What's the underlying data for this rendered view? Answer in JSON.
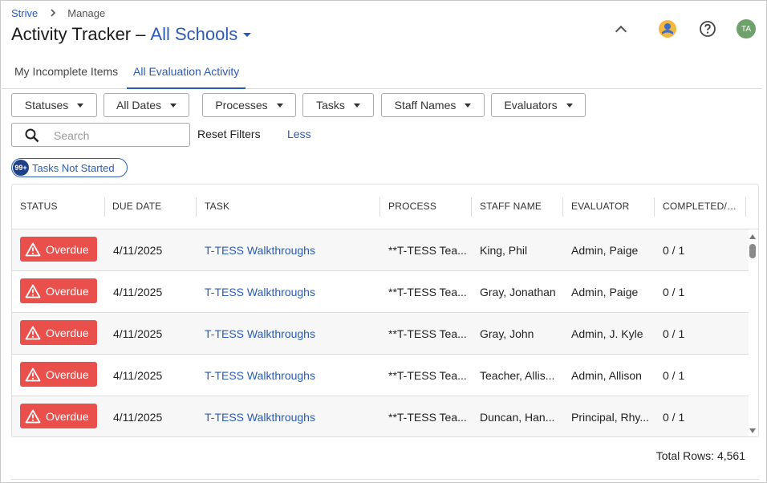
{
  "breadcrumb": {
    "root": "Strive",
    "current": "Manage"
  },
  "header": {
    "title": "Activity Tracker",
    "dash": "–",
    "school": "All Schools",
    "avatar_initials": "TA"
  },
  "tabs": [
    {
      "label": "My Incomplete Items",
      "active": false
    },
    {
      "label": "All Evaluation Activity",
      "active": true
    }
  ],
  "filters": {
    "statuses": "Statuses",
    "dates": "All Dates",
    "processes": "Processes",
    "tasks": "Tasks",
    "staff_names": "Staff Names",
    "evaluators": "Evaluators"
  },
  "search": {
    "placeholder": "Search",
    "value": ""
  },
  "actions": {
    "reset": "Reset Filters",
    "less": "Less"
  },
  "chip": {
    "count": "99+",
    "label": "Tasks Not Started"
  },
  "table": {
    "columns": [
      "STATUS",
      "DUE DATE",
      "TASK",
      "PROCESS",
      "STAFF NAME",
      "EVALUATOR",
      "COMPLETED/RE..."
    ],
    "rows": [
      {
        "status": "Overdue",
        "due": "4/11/2025",
        "task": "T-TESS Walkthroughs",
        "process": "**T-TESS Tea...",
        "staff": "King, Phil",
        "evaluator": "Admin, Paige",
        "completed": "0 / 1"
      },
      {
        "status": "Overdue",
        "due": "4/11/2025",
        "task": "T-TESS Walkthroughs",
        "process": "**T-TESS Tea...",
        "staff": "Gray, Jonathan",
        "evaluator": "Admin, Paige",
        "completed": "0 / 1"
      },
      {
        "status": "Overdue",
        "due": "4/11/2025",
        "task": "T-TESS Walkthroughs",
        "process": "**T-TESS Tea...",
        "staff": "Gray, John",
        "evaluator": "Admin, J. Kyle",
        "completed": "0 / 1"
      },
      {
        "status": "Overdue",
        "due": "4/11/2025",
        "task": "T-TESS Walkthroughs",
        "process": "**T-TESS Tea...",
        "staff": "Teacher, Allis...",
        "evaluator": "Admin, Allison",
        "completed": "0 / 1"
      },
      {
        "status": "Overdue",
        "due": "4/11/2025",
        "task": "T-TESS Walkthroughs",
        "process": "**T-TESS Tea...",
        "staff": "Duncan, Han...",
        "evaluator": "Principal, Rhy...",
        "completed": "0 / 1"
      }
    ]
  },
  "footer": {
    "total_rows": "Total Rows: 4,561"
  },
  "colors": {
    "accent": "#2b5bb5",
    "overdue": "#e9504c",
    "chip_badge": "#1e3f8a",
    "avatar": "#6fa16b"
  }
}
